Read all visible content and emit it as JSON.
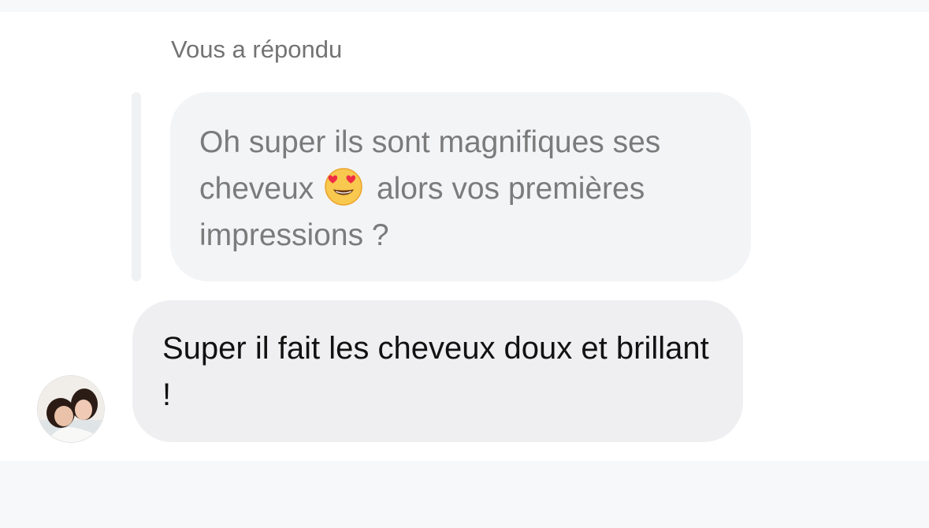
{
  "thread": {
    "reply_context": "Vous a répondu",
    "quoted_message": {
      "text_before_emoji": "Oh super ils sont magnifiques ses cheveux",
      "emoji": "smiling-face-with-heart-eyes-icon",
      "text_after_emoji": "alors vos premières impressions ?"
    },
    "reply_message": {
      "text": "Super il fait les cheveux doux et brillant !"
    },
    "avatar": {
      "icon": "user-avatar-photo"
    }
  },
  "colors": {
    "panel_background": "#ffffff",
    "page_background": "#f7f8fa",
    "quoted_bubble": "#f3f4f6",
    "reply_bubble": "#efeff1",
    "quoted_text": "#7b7b7b",
    "reply_text": "#111111",
    "header_text": "#737373"
  }
}
